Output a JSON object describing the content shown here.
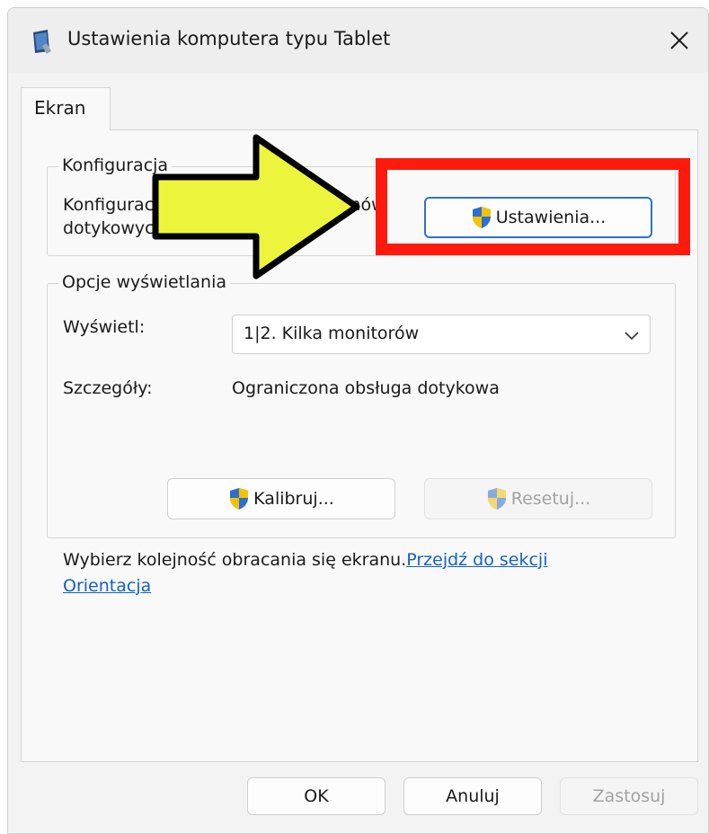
{
  "window": {
    "title": "Ustawienia komputera typu Tablet",
    "app_icon": "tablet-pc-icon",
    "close_glyph": "✕"
  },
  "tabs": [
    {
      "label": "Ekran",
      "selected": true
    }
  ],
  "configuration": {
    "group_label": "Konfiguracja",
    "description_line1": "Konfiguracja ekranów pióra i ekranów",
    "description_line2": "dotykowych",
    "settings_button": "Ustawienia..."
  },
  "display_options": {
    "group_label": "Opcje wyświetlania",
    "display_label": "Wyświetl:",
    "display_value": "1|2. Kilka monitorów",
    "details_label": "Szczegóły:",
    "details_value": "Ograniczona obsługa dotykowa",
    "calibrate_button": "Kalibruj...",
    "reset_button": "Resetuj..."
  },
  "orientation_hint": {
    "text": "Wybierz kolejność obracania się ekranu.",
    "link": "Przejdź do sekcji Orientacja"
  },
  "footer": {
    "ok": "OK",
    "cancel": "Anuluj",
    "apply": "Zastosuj"
  },
  "annotation": {
    "highlight_color": "#ff1a0d",
    "arrow_color": "#ecf53b",
    "arrow_icon": "yellow-arrow-right-icon"
  },
  "colors": {
    "accent": "#2d73c6",
    "link": "#1560c8"
  }
}
